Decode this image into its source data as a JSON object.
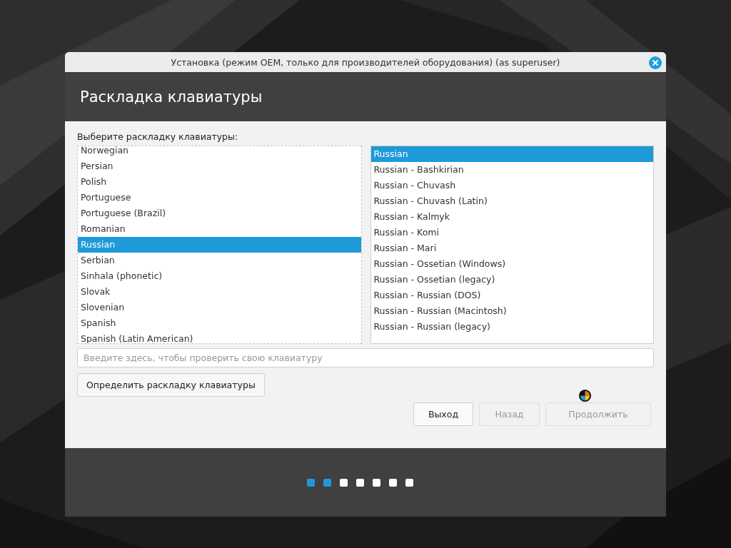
{
  "window": {
    "title": "Установка (режим OEM, только для производителей оборудования) (as superuser)"
  },
  "header": {
    "title": "Раскладка клавиатуры"
  },
  "layout_label": "Выберите раскладку клавиатуры:",
  "layouts": [
    {
      "label": "Norwegian",
      "selected": false
    },
    {
      "label": "Persian",
      "selected": false
    },
    {
      "label": "Polish",
      "selected": false
    },
    {
      "label": "Portuguese",
      "selected": false
    },
    {
      "label": "Portuguese (Brazil)",
      "selected": false
    },
    {
      "label": "Romanian",
      "selected": false
    },
    {
      "label": "Russian",
      "selected": true
    },
    {
      "label": "Serbian",
      "selected": false
    },
    {
      "label": "Sinhala (phonetic)",
      "selected": false
    },
    {
      "label": "Slovak",
      "selected": false
    },
    {
      "label": "Slovenian",
      "selected": false
    },
    {
      "label": "Spanish",
      "selected": false
    },
    {
      "label": "Spanish (Latin American)",
      "selected": false
    }
  ],
  "variants": [
    {
      "label": "Russian",
      "selected": true
    },
    {
      "label": "Russian - Bashkirian",
      "selected": false
    },
    {
      "label": "Russian - Chuvash",
      "selected": false
    },
    {
      "label": "Russian - Chuvash (Latin)",
      "selected": false
    },
    {
      "label": "Russian - Kalmyk",
      "selected": false
    },
    {
      "label": "Russian - Komi",
      "selected": false
    },
    {
      "label": "Russian - Mari",
      "selected": false
    },
    {
      "label": "Russian - Ossetian (Windows)",
      "selected": false
    },
    {
      "label": "Russian - Ossetian (legacy)",
      "selected": false
    },
    {
      "label": "Russian - Russian (DOS)",
      "selected": false
    },
    {
      "label": "Russian - Russian (Macintosh)",
      "selected": false
    },
    {
      "label": "Russian - Russian (legacy)",
      "selected": false
    }
  ],
  "test_field": {
    "placeholder": "Введите здесь, чтобы проверить свою клавиатуру"
  },
  "detect_button": "Определить раскладку клавиатуры",
  "buttons": [
    {
      "label": "Выход",
      "disabled": false
    },
    {
      "label": "Назад",
      "disabled": true
    },
    {
      "label": "Продолжить",
      "disabled": true
    }
  ],
  "steps": [
    {
      "done": true
    },
    {
      "done": true
    },
    {
      "done": false
    },
    {
      "done": false
    },
    {
      "done": false
    },
    {
      "done": false
    },
    {
      "done": false
    }
  ]
}
